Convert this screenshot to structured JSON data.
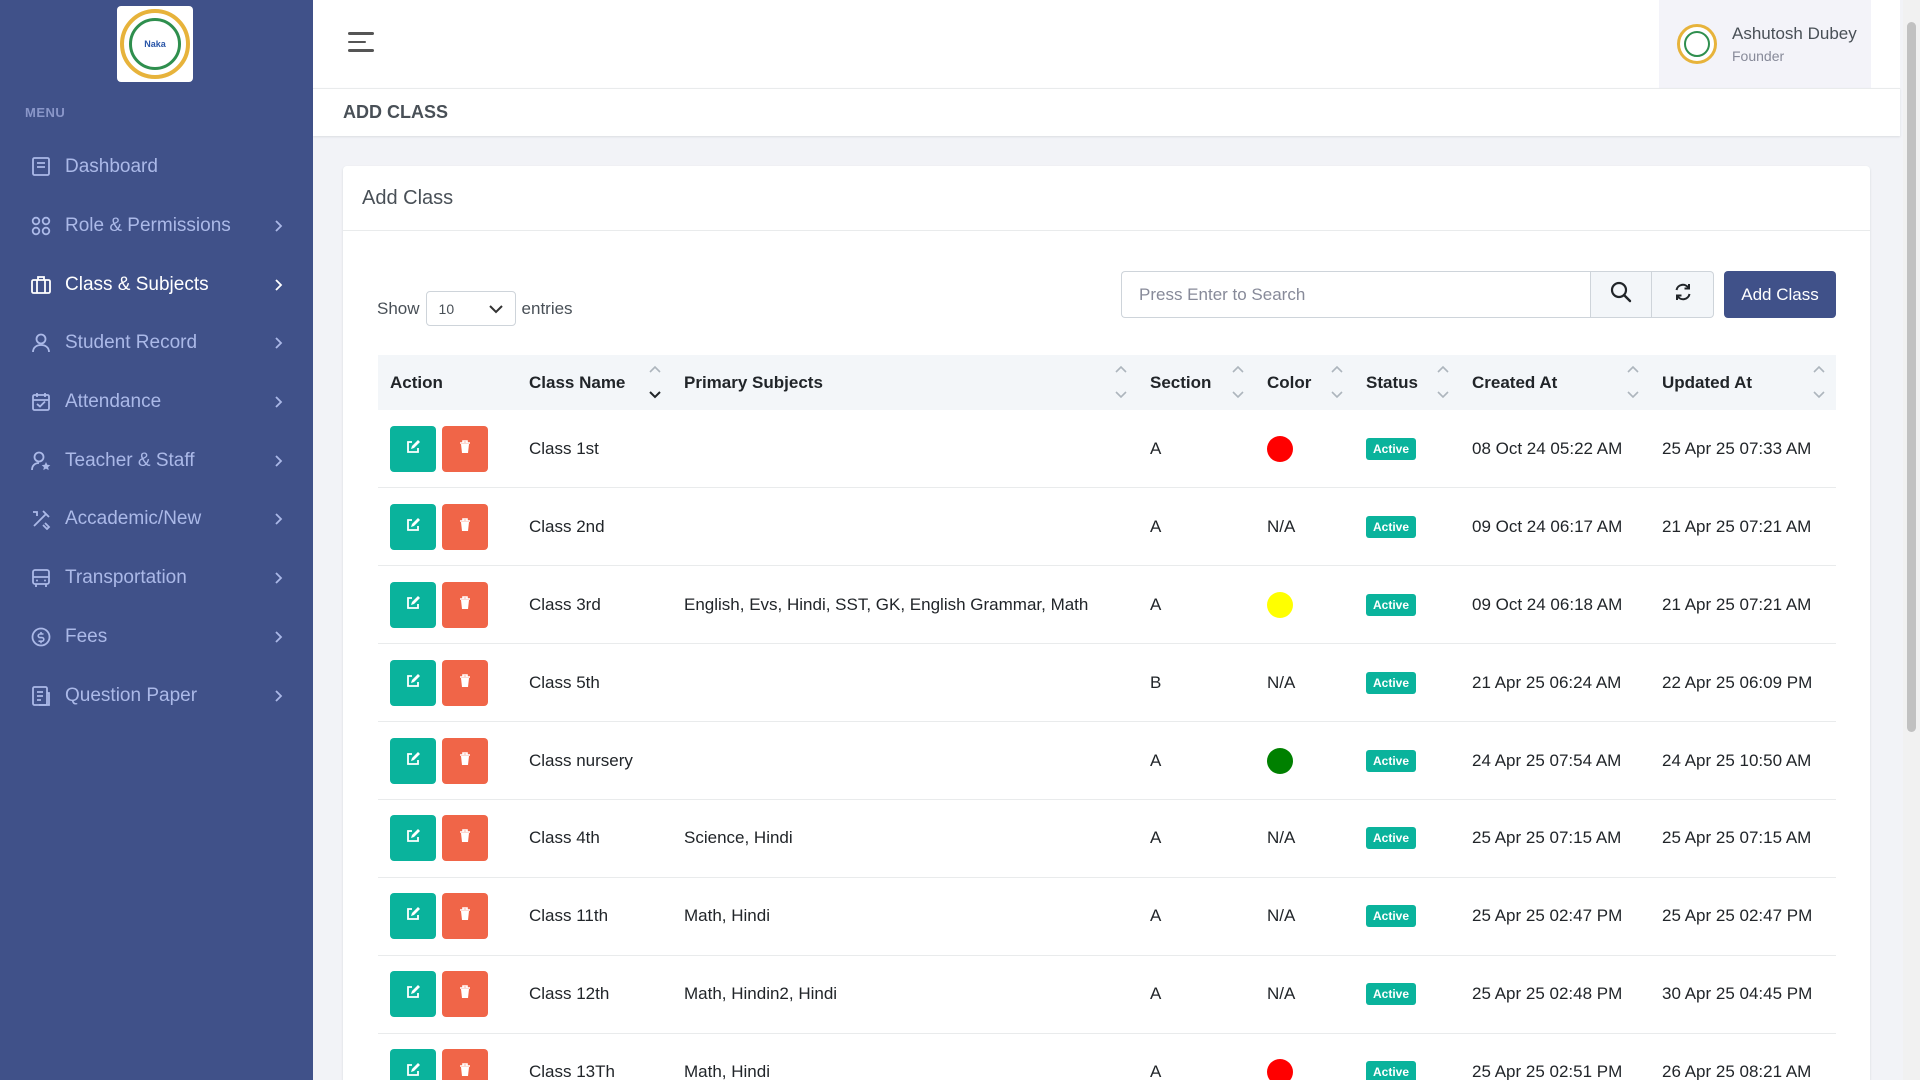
{
  "sidebar": {
    "menu_label": "MENU",
    "logo_text": "Naka",
    "items": [
      {
        "label": "Dashboard",
        "icon": "dashboard-icon",
        "has_chevron": false,
        "active": false
      },
      {
        "label": "Role & Permissions",
        "icon": "grid-icon",
        "has_chevron": true,
        "active": false
      },
      {
        "label": "Class & Subjects",
        "icon": "briefcase-icon",
        "has_chevron": true,
        "active": true
      },
      {
        "label": "Student Record",
        "icon": "user-icon",
        "has_chevron": true,
        "active": false
      },
      {
        "label": "Attendance",
        "icon": "calendar-icon",
        "has_chevron": true,
        "active": false
      },
      {
        "label": "Teacher & Staff",
        "icon": "user-star-icon",
        "has_chevron": true,
        "active": false
      },
      {
        "label": "Accademic/New",
        "icon": "tools-icon",
        "has_chevron": true,
        "active": false
      },
      {
        "label": "Transportation",
        "icon": "bus-icon",
        "has_chevron": true,
        "active": false
      },
      {
        "label": "Fees",
        "icon": "coin-icon",
        "has_chevron": true,
        "active": false
      },
      {
        "label": "Question Paper",
        "icon": "document-icon",
        "has_chevron": true,
        "active": false
      }
    ]
  },
  "topbar": {
    "user_name": "Ashutosh Dubey",
    "user_role": "Founder"
  },
  "page_title": "ADD CLASS",
  "card": {
    "title": "Add Class",
    "show_label": "Show",
    "entries_value": "10",
    "entries_label": "entries",
    "search_placeholder": "Press Enter to Search",
    "add_button": "Add Class"
  },
  "table": {
    "headers": [
      "Action",
      "Class Name",
      "Primary Subjects",
      "Section",
      "Color",
      "Status",
      "Created At",
      "Updated At"
    ],
    "rows": [
      {
        "class_name": "Class 1st",
        "subjects": "",
        "section": "A",
        "color": "#ff0000",
        "color_text": "",
        "status": "Active",
        "created": "08 Oct 24 05:22 AM",
        "updated": "25 Apr 25 07:33 AM"
      },
      {
        "class_name": "Class 2nd",
        "subjects": "",
        "section": "A",
        "color": "",
        "color_text": "N/A",
        "status": "Active",
        "created": "09 Oct 24 06:17 AM",
        "updated": "21 Apr 25 07:21 AM"
      },
      {
        "class_name": "Class 3rd",
        "subjects": "English, Evs, Hindi, SST, GK, English Grammar, Math",
        "section": "A",
        "color": "#ffff00",
        "color_text": "",
        "status": "Active",
        "created": "09 Oct 24 06:18 AM",
        "updated": "21 Apr 25 07:21 AM"
      },
      {
        "class_name": "Class 5th",
        "subjects": "",
        "section": "B",
        "color": "",
        "color_text": "N/A",
        "status": "Active",
        "created": "21 Apr 25 06:24 AM",
        "updated": "22 Apr 25 06:09 PM"
      },
      {
        "class_name": "Class nursery",
        "subjects": "",
        "section": "A",
        "color": "#008000",
        "color_text": "",
        "status": "Active",
        "created": "24 Apr 25 07:54 AM",
        "updated": "24 Apr 25 10:50 AM"
      },
      {
        "class_name": "Class 4th",
        "subjects": "Science, Hindi",
        "section": "A",
        "color": "",
        "color_text": "N/A",
        "status": "Active",
        "created": "25 Apr 25 07:15 AM",
        "updated": "25 Apr 25 07:15 AM"
      },
      {
        "class_name": "Class 11th",
        "subjects": "Math, Hindi",
        "section": "A",
        "color": "",
        "color_text": "N/A",
        "status": "Active",
        "created": "25 Apr 25 02:47 PM",
        "updated": "25 Apr 25 02:47 PM"
      },
      {
        "class_name": "Class 12th",
        "subjects": "Math, Hindin2, Hindi",
        "section": "A",
        "color": "",
        "color_text": "N/A",
        "status": "Active",
        "created": "25 Apr 25 02:48 PM",
        "updated": "30 Apr 25 04:45 PM"
      },
      {
        "class_name": "Class 13Th",
        "subjects": "Math, Hindi",
        "section": "A",
        "color": "#ff0000",
        "color_text": "",
        "status": "Active",
        "created": "25 Apr 25 02:51 PM",
        "updated": "26 Apr 25 08:21 AM"
      }
    ]
  },
  "colors": {
    "sidebar_bg": "#405189",
    "primary": "#405189",
    "success": "#0ab39c",
    "danger": "#f06548"
  }
}
